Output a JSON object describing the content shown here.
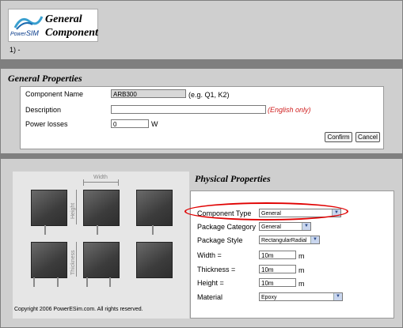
{
  "header": {
    "logo_brand_small": "Power",
    "logo_brand_large": "SIM",
    "logo_title_line1": "General",
    "logo_title_line2": "Component",
    "step_text": "1) -"
  },
  "general_properties": {
    "title": "General Properties",
    "component_name_label": "Component Name",
    "component_name_value": "ARB300",
    "component_name_hint": "(e.g. Q1, K2)",
    "description_label": "Description",
    "description_value": "",
    "description_hint": "(English only)",
    "power_losses_label": "Power losses",
    "power_losses_value": "0",
    "power_losses_unit": "W",
    "confirm_label": "Confirm",
    "cancel_label": "Cancel"
  },
  "diagram": {
    "width_label": "Width",
    "height_label": "Height",
    "thickness_label": "Thickness",
    "copyright": "Copyright 2006 PowerESim.com. All rights reserved."
  },
  "physical_properties": {
    "title": "Physical Properties",
    "component_type_label": "Component Type",
    "component_type_value": "General",
    "package_category_label": "Package Category",
    "package_category_value": "General",
    "package_style_label": "Package Style",
    "package_style_value": "RectangularRadial",
    "width_label": "Width =",
    "width_value": "10m",
    "thickness_label": "Thickness =",
    "thickness_value": "10m",
    "height_label": "Height =",
    "height_value": "10m",
    "unit": "m",
    "material_label": "Material",
    "material_value": "Epoxy"
  },
  "colors": {
    "background": "#7f7f7f",
    "panel": "#cfcfcf",
    "highlight_oval": "#e00000",
    "hint_red": "#d02020"
  },
  "icons": [
    "dropdown-arrow-icon",
    "powersim-logo"
  ]
}
